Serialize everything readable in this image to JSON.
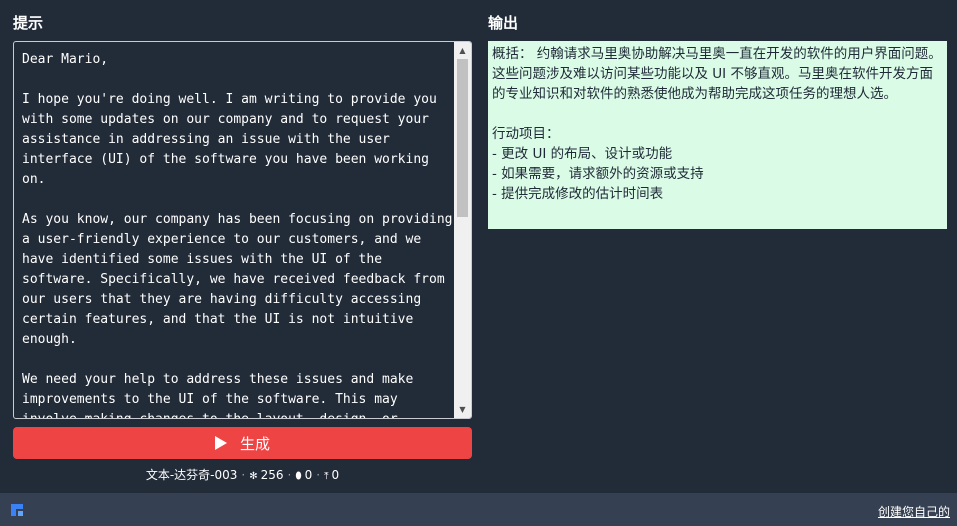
{
  "prompt_panel": {
    "title": "提示",
    "text": "Dear Mario,\n\nI hope you're doing well. I am writing to provide you with some updates on our company and to request your assistance in addressing an issue with the user interface (UI) of the software you have been working on.\n\nAs you know, our company has been focusing on providing a user-friendly experience to our customers, and we have identified some issues with the UI of the software. Specifically, we have received feedback from our users that they are having difficulty accessing certain features, and that the UI is not intuitive enough.\n\nWe need your help to address these issues and make improvements to the UI of the software. This may involve making changes to the layout, design, or"
  },
  "generate_button": {
    "label": "生成",
    "color": "#ef4444"
  },
  "meta": {
    "model": "文本-达芬奇-003",
    "temperature_icon": "temperature-icon",
    "temperature": "256",
    "drop_icon": "drop-icon",
    "drop_value": "0",
    "upload_icon": "upload-icon",
    "upload_value": "0"
  },
  "output_panel": {
    "title": "输出",
    "text": "概括： 约翰请求马里奥协助解决马里奥一直在开发的软件的用户界面问题。这些问题涉及难以访问某些功能以及 UI 不够直观。马里奥在软件开发方面的专业知识和对软件的熟悉使他成为帮助完成这项任务的理想人选。\n\n行动项目：\n- 更改 UI 的布局、设计或功能\n- 如果需要，请求额外的资源或支持\n- 提供完成修改的估计时间表",
    "background": "#dafbe6"
  },
  "footer": {
    "logo_icon": "app-logo-icon",
    "link_label": "创建您自己的"
  }
}
